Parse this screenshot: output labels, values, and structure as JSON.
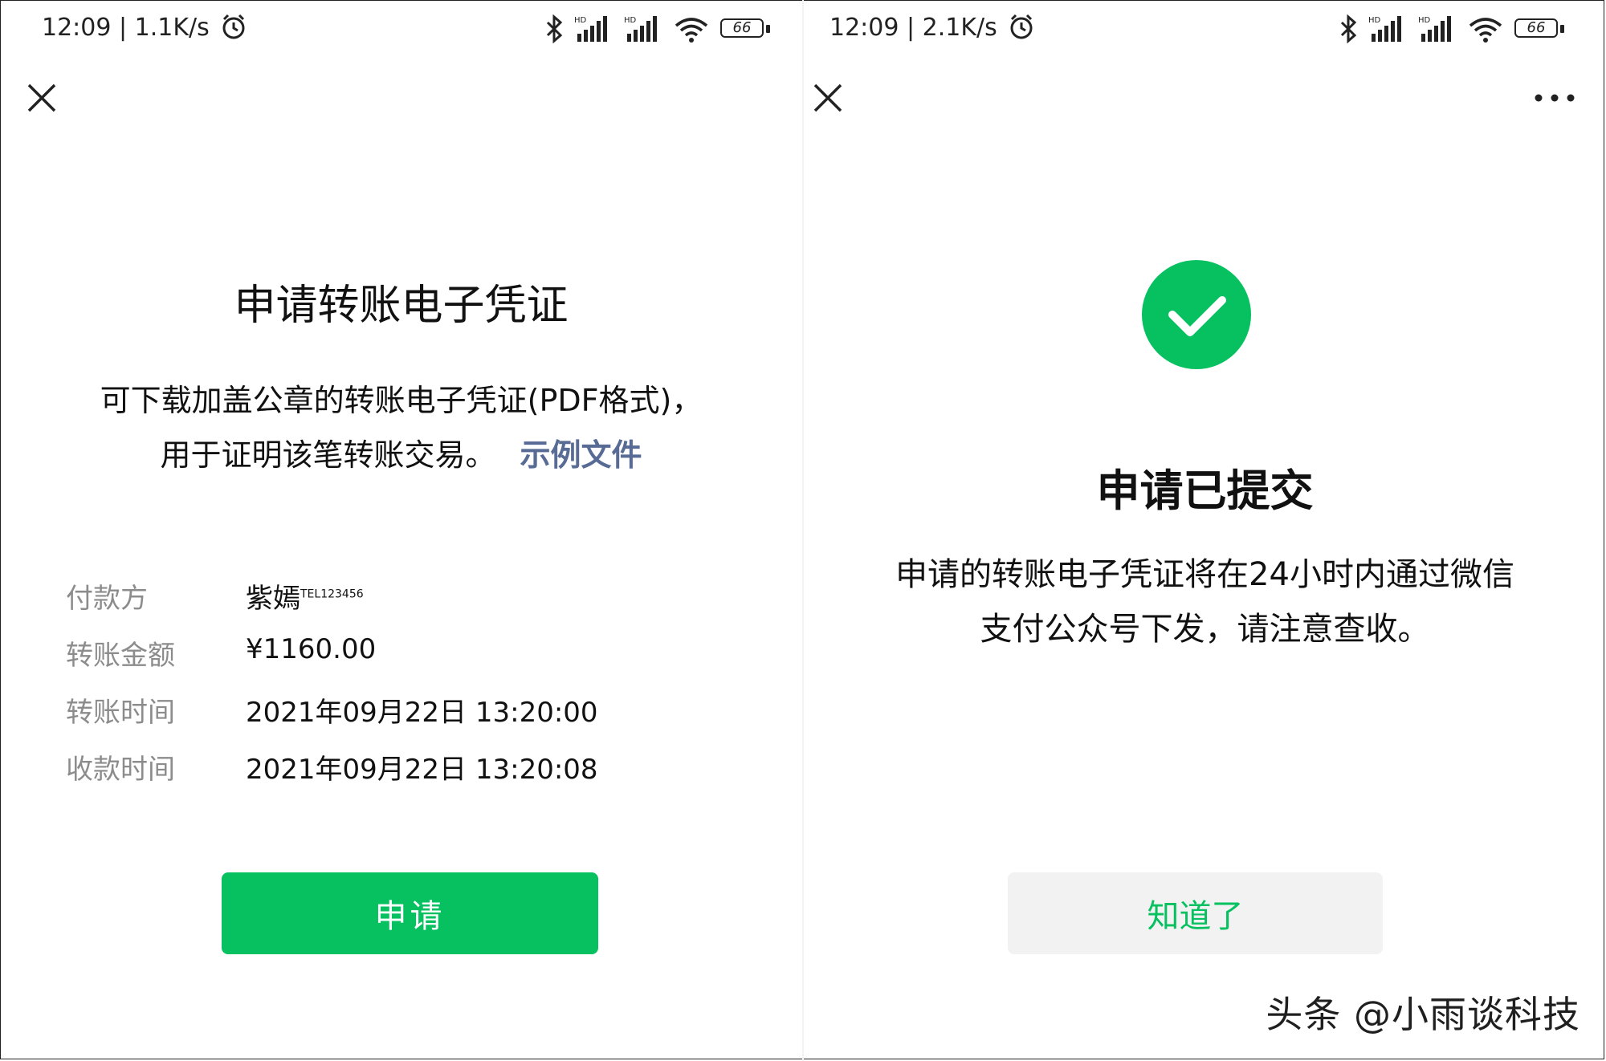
{
  "left": {
    "status": {
      "time_speed": "12:09 | 1.1K/s",
      "battery": "66"
    },
    "title": "申请转账电子凭证",
    "description_line1": "可下载加盖公章的转账电子凭证(PDF格式)，",
    "description_line2": "用于证明该笔转账交易。",
    "example_link": "示例文件",
    "rows": [
      {
        "label": "付款方",
        "value": "紫嫣",
        "value_sup": "TEL123456"
      },
      {
        "label": "转账金额",
        "value": "¥1160.00"
      },
      {
        "label": "转账时间",
        "value": "2021年09月22日 13:20:00"
      },
      {
        "label": "收款时间",
        "value": "2021年09月22日 13:20:08"
      }
    ],
    "apply_button": "申请"
  },
  "right": {
    "status": {
      "time_speed": "12:09 | 2.1K/s",
      "battery": "66"
    },
    "title": "申请已提交",
    "description_line1": "申请的转账电子凭证将在24小时内通过微信",
    "description_line2": "支付公众号下发，请注意查收。",
    "ok_button": "知道了"
  },
  "watermark": "头条 @小雨谈科技",
  "colors": {
    "brand_green": "#07c160",
    "link_blue": "#576b95",
    "label_gray": "#8c8c8c"
  },
  "icons": [
    "alarm-icon",
    "bluetooth-icon",
    "signal-icon",
    "wifi-icon",
    "battery-icon",
    "close-icon",
    "more-icon",
    "checkmark-icon"
  ]
}
